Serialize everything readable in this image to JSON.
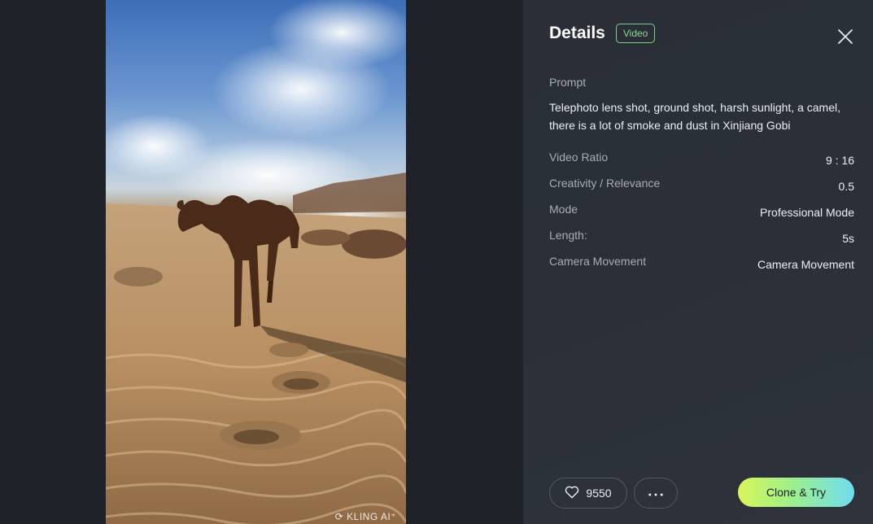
{
  "details": {
    "title": "Details",
    "type_badge": "Video",
    "prompt_label": "Prompt",
    "prompt_text": "Telephoto lens shot, ground shot, harsh sunlight, a camel, there is a lot of smoke and dust in Xinjiang Gobi",
    "attributes": [
      {
        "label": "Video Ratio",
        "value": "9 : 16"
      },
      {
        "label": "Creativity / Relevance",
        "value": "0.5"
      },
      {
        "label": "Mode",
        "value": "Professional Mode"
      },
      {
        "label": "Length:",
        "value": "5s"
      },
      {
        "label": "Camera Movement",
        "value": "Camera Movement"
      }
    ]
  },
  "actions": {
    "like_count": "9550",
    "clone_label": "Clone & Try"
  },
  "media": {
    "watermark": "KLING AI⁺"
  },
  "icons": {
    "close": "close-icon",
    "heart": "heart-icon",
    "more": "more-dots-icon",
    "watermark_logo": "kling-logo-icon"
  },
  "colors": {
    "badge_green": "#8ad694",
    "clone_gradient_start": "#d9f55a",
    "clone_gradient_end": "#6fdcf0",
    "panel_bg": "#2b3038",
    "stage_bg": "#1f2329"
  }
}
